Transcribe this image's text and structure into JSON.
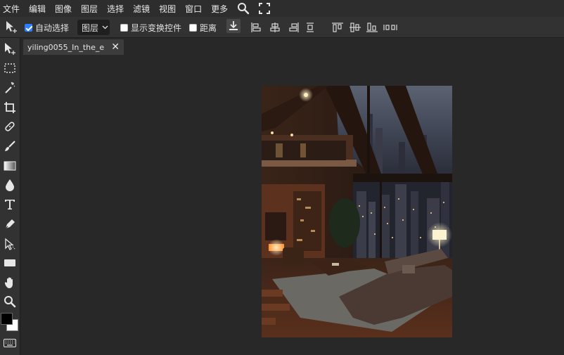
{
  "menubar": {
    "items": [
      "文件",
      "编辑",
      "图像",
      "图层",
      "选择",
      "滤镜",
      "视图",
      "窗口",
      "更多"
    ]
  },
  "options": {
    "auto_select_label": "自动选择",
    "auto_select_checked": true,
    "layer_select_value": "图层",
    "show_transform_label": "显示变换控件",
    "show_transform_checked": false,
    "distance_label": "距离",
    "distance_checked": false
  },
  "document": {
    "tab_title": "yiling0055_In_the_e"
  },
  "colors": {
    "foreground": "#000000",
    "background": "#ffffff",
    "accent": "#2a7fff"
  },
  "icons": {
    "menubar": [
      "search-icon",
      "fullscreen-icon"
    ],
    "tools": [
      "move-tool",
      "marquee-tool",
      "magic-wand-tool",
      "crop-tool",
      "healing-tool",
      "brush-tool",
      "gradient-tool",
      "blur-tool",
      "type-tool",
      "pen-tool",
      "path-select-tool",
      "rectangle-tool",
      "hand-tool",
      "zoom-tool",
      "keyboard-icon"
    ]
  }
}
